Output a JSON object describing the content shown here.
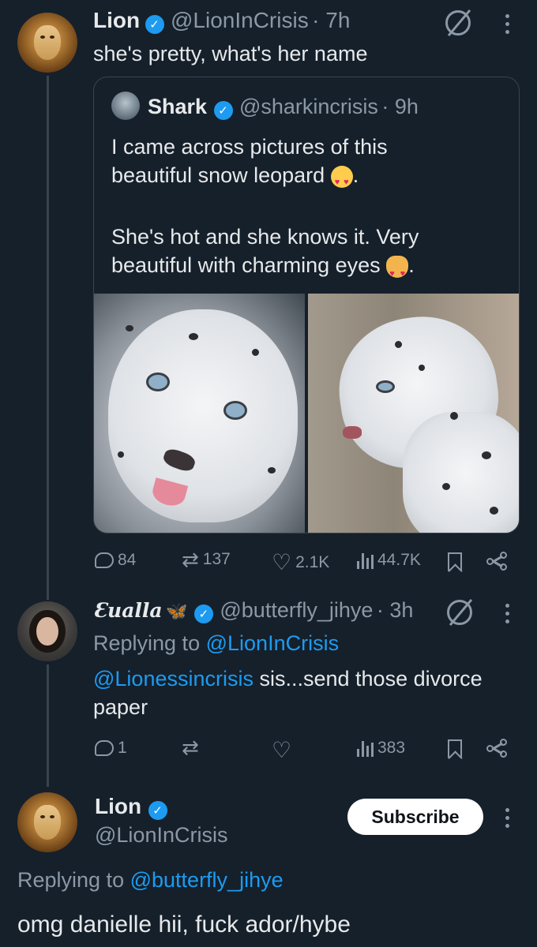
{
  "tweet1": {
    "name": "Lion",
    "handle": "@LionInCrisis",
    "time": "· 7h",
    "text": "she's pretty, what's her name",
    "quote": {
      "name": "Shark",
      "handle": "@sharkincrisis",
      "time": "· 9h",
      "line1": "I came across pictures of this",
      "line2": "beautiful snow leopard",
      "line2_end": ".",
      "line3": "She's hot and she knows it. Very",
      "line4": "beautiful with charming eyes",
      "line4_end": "."
    },
    "actions": {
      "replies": "84",
      "retweets": "137",
      "likes": "2.1K",
      "views": "44.7K"
    }
  },
  "tweet2": {
    "name": "Ɛualla",
    "handle": "@butterfly_jihye",
    "time": "· 3h",
    "replying_prefix": "Replying to",
    "replying_to": "@LionInCrisis",
    "mention": "@Lionessincrisis",
    "text_rest": " sis...send those divorce",
    "text_line2": "paper",
    "actions": {
      "replies": "1",
      "views": "383"
    }
  },
  "tweet3": {
    "name": "Lion",
    "handle": "@LionInCrisis",
    "subscribe_label": "Subscribe",
    "replying_prefix": "Replying to",
    "replying_to": "@butterfly_jihye",
    "text": "omg danielle hii, fuck ador/hybe"
  },
  "colors": {
    "background": "#15202b",
    "text": "#e7e9ea",
    "secondary": "#8b98a5",
    "accent": "#1d9bf0",
    "border": "#38444d"
  },
  "icons": [
    "verified-icon",
    "grok-icon",
    "more-icon",
    "reply-icon",
    "retweet-icon",
    "like-icon",
    "views-icon",
    "bookmark-icon",
    "share-icon"
  ]
}
